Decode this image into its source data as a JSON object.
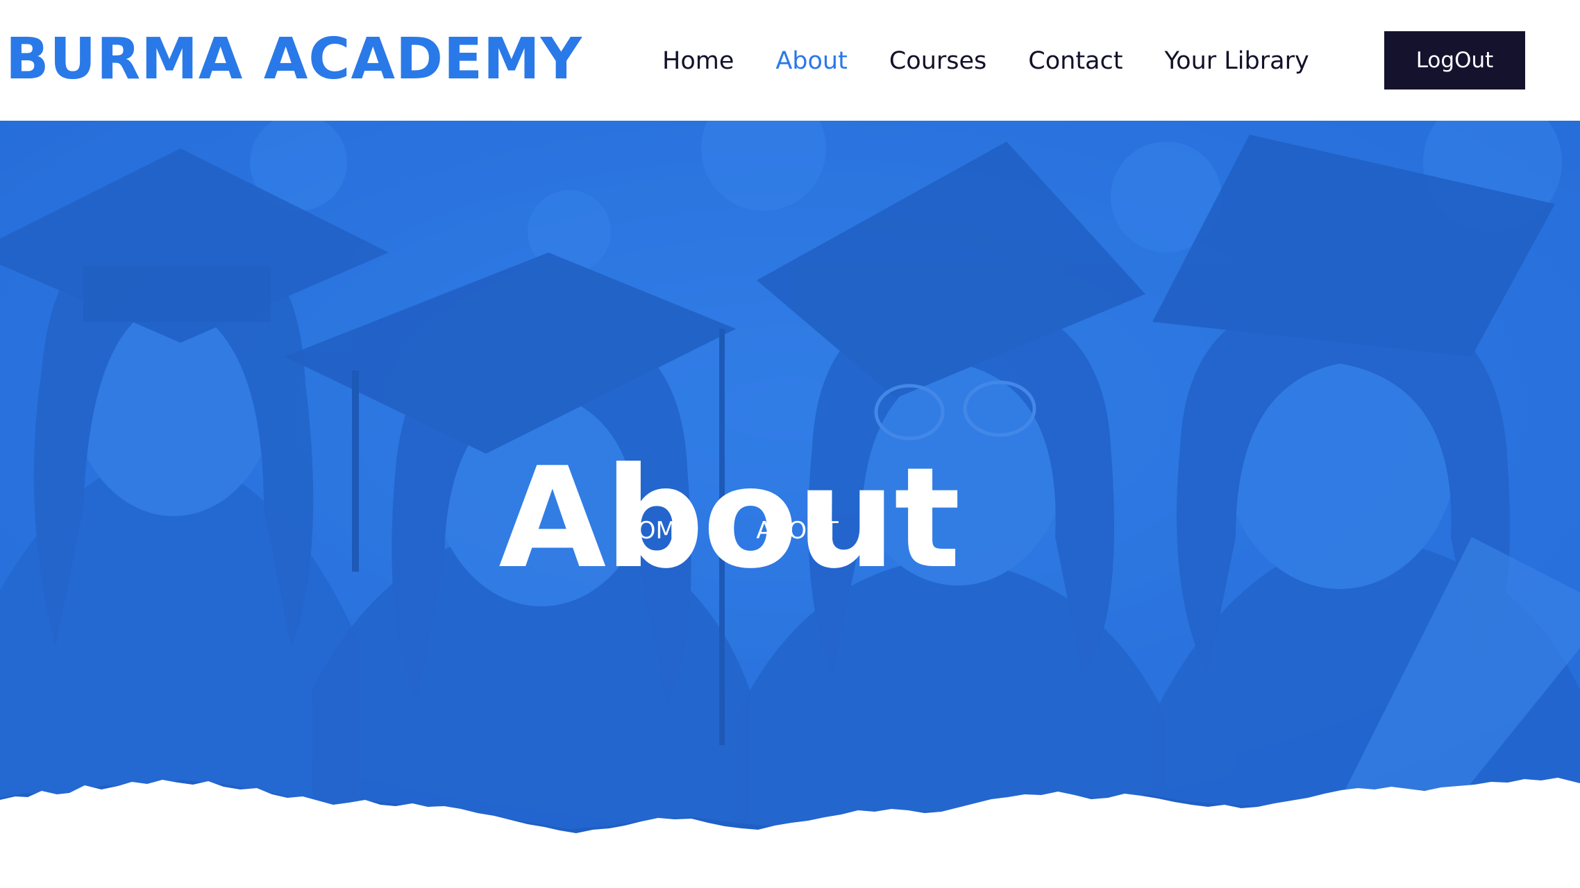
{
  "header": {
    "brand": "BURMA ACADEMY",
    "nav": [
      {
        "label": "Home",
        "active": false
      },
      {
        "label": "About",
        "active": true
      },
      {
        "label": "Courses",
        "active": false
      },
      {
        "label": "Contact",
        "active": false
      },
      {
        "label": "Your Library",
        "active": false
      }
    ],
    "logout_label": "LogOut"
  },
  "hero": {
    "title": "About",
    "breadcrumb": {
      "home": "HOME",
      "separator_icon": "double-chevron-right-icon",
      "current": "ABOUT"
    },
    "background_image": "graduates-in-caps-photo"
  },
  "colors": {
    "accent": "#2a79e8",
    "nav_text": "#12112a",
    "button_bg": "#15122e",
    "hero_overlay": "#2b74dc"
  }
}
